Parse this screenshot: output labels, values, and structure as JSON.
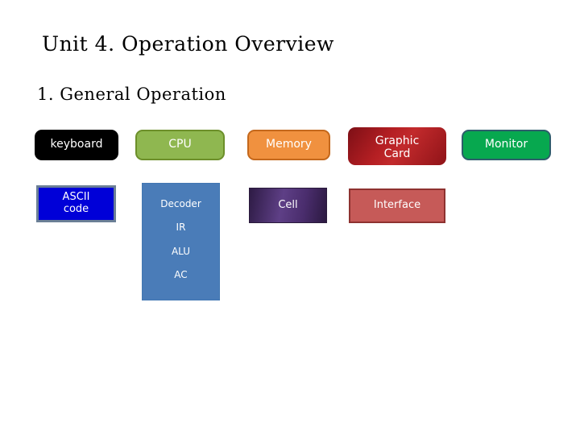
{
  "slide": {
    "title": "Unit 4. Operation Overview",
    "section_title": "1. General Operation",
    "background_color": "#ffffff"
  },
  "diagram": {
    "row1": [
      {
        "id": "keyboard",
        "label": "keyboard",
        "fill": "#000000",
        "border": "#000000",
        "text_color": "#ffffff",
        "shape": "rounded"
      },
      {
        "id": "cpu",
        "label": "CPU",
        "fill": "#8fb750",
        "border": "#6c8f2a",
        "text_color": "#ffffff",
        "shape": "rounded"
      },
      {
        "id": "memory",
        "label": "Memory",
        "fill": "#f0913f",
        "border": "#c4681c",
        "text_color": "#ffffff",
        "shape": "rounded"
      },
      {
        "id": "graphic-card",
        "label": "Graphic\nCard",
        "fill": "#b51f23",
        "border": "#7d0f16",
        "text_color": "#ffffff",
        "shape": "rounded"
      },
      {
        "id": "monitor",
        "label": "Monitor",
        "fill": "#07a84f",
        "border": "#2e5d6b",
        "text_color": "#ffffff",
        "shape": "rounded"
      }
    ],
    "row2": [
      {
        "id": "ascii-code",
        "label": "ASCII\ncode",
        "fill": "#0000d8",
        "border": "#6b7f96",
        "text_color": "#ffffff",
        "shape": "rect"
      },
      {
        "id": "cell",
        "label": "Cell",
        "fill": "#5e3f86",
        "border": "#2a1a3c",
        "text_color": "#ffffff",
        "shape": "rect"
      },
      {
        "id": "interface",
        "label": "Interface",
        "fill": "#c65a58",
        "border": "#8e3230",
        "text_color": "#ffffff",
        "shape": "rect"
      }
    ],
    "cpu_internals": {
      "fill": "#4a7cb8",
      "text_color": "#ffffff",
      "items": [
        "Decoder",
        "IR",
        "ALU",
        "AC"
      ]
    }
  }
}
